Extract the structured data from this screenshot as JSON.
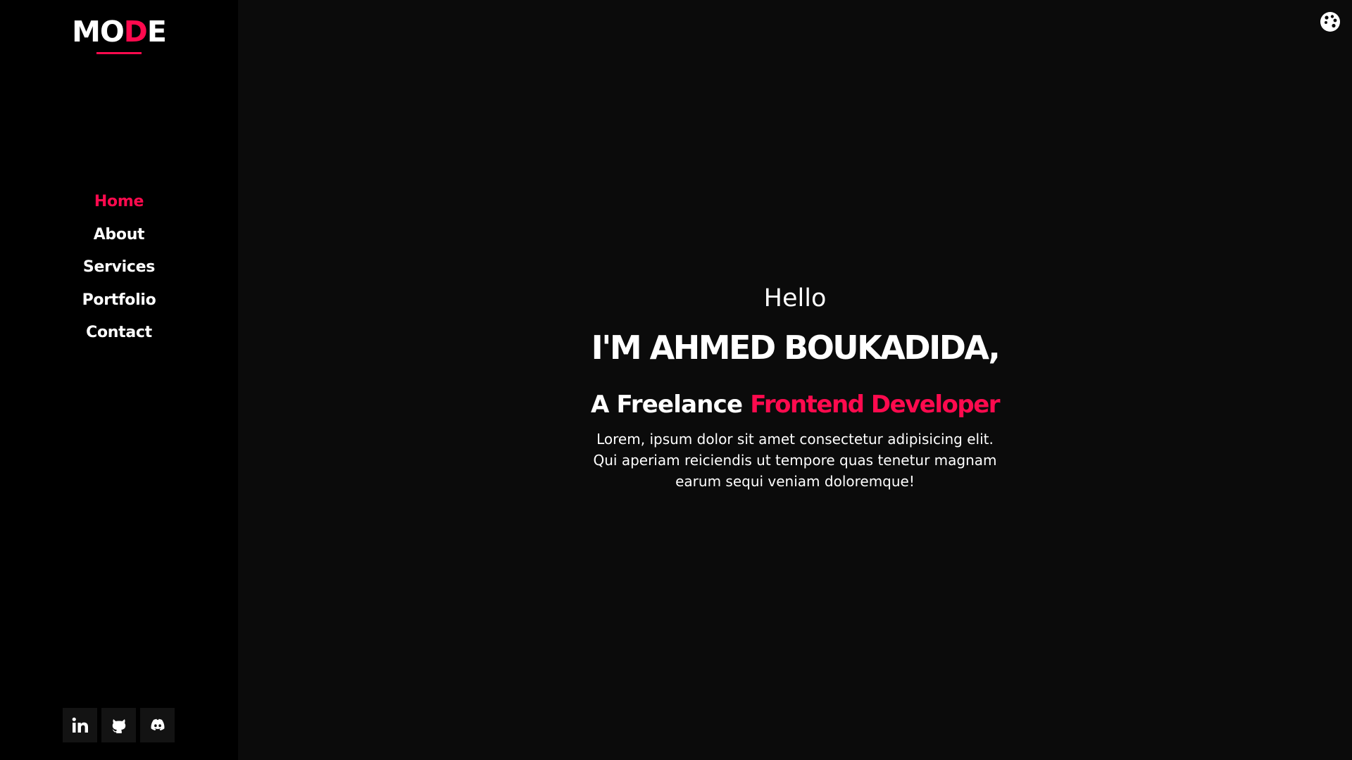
{
  "brand": {
    "logo_part1": "MO",
    "logo_part2": "D",
    "logo_part3": "E"
  },
  "nav": {
    "items": [
      {
        "label": "Home",
        "active": true
      },
      {
        "label": "About",
        "active": false
      },
      {
        "label": "Services",
        "active": false
      },
      {
        "label": "Portfolio",
        "active": false
      },
      {
        "label": "Contact",
        "active": false
      }
    ]
  },
  "socials": [
    {
      "icon": "linkedin-icon"
    },
    {
      "icon": "github-icon"
    },
    {
      "icon": "discord-icon"
    }
  ],
  "settings": {
    "icon": "palette-icon"
  },
  "hero": {
    "greeting": "Hello",
    "name": "I'M AHMED BOUKADIDA,",
    "role_prefix": "A Freelance ",
    "role_highlight": "Frontend Developer",
    "description": "Lorem, ipsum dolor sit amet consectetur adipisicing elit. Qui aperiam reiciendis ut tempore quas tenetur magnam earum sequi veniam doloremque!"
  },
  "colors": {
    "accent": "#ff0a4e",
    "sidebar_bg": "#000000",
    "main_bg": "#0b0b0b",
    "text": "#ffffff"
  }
}
